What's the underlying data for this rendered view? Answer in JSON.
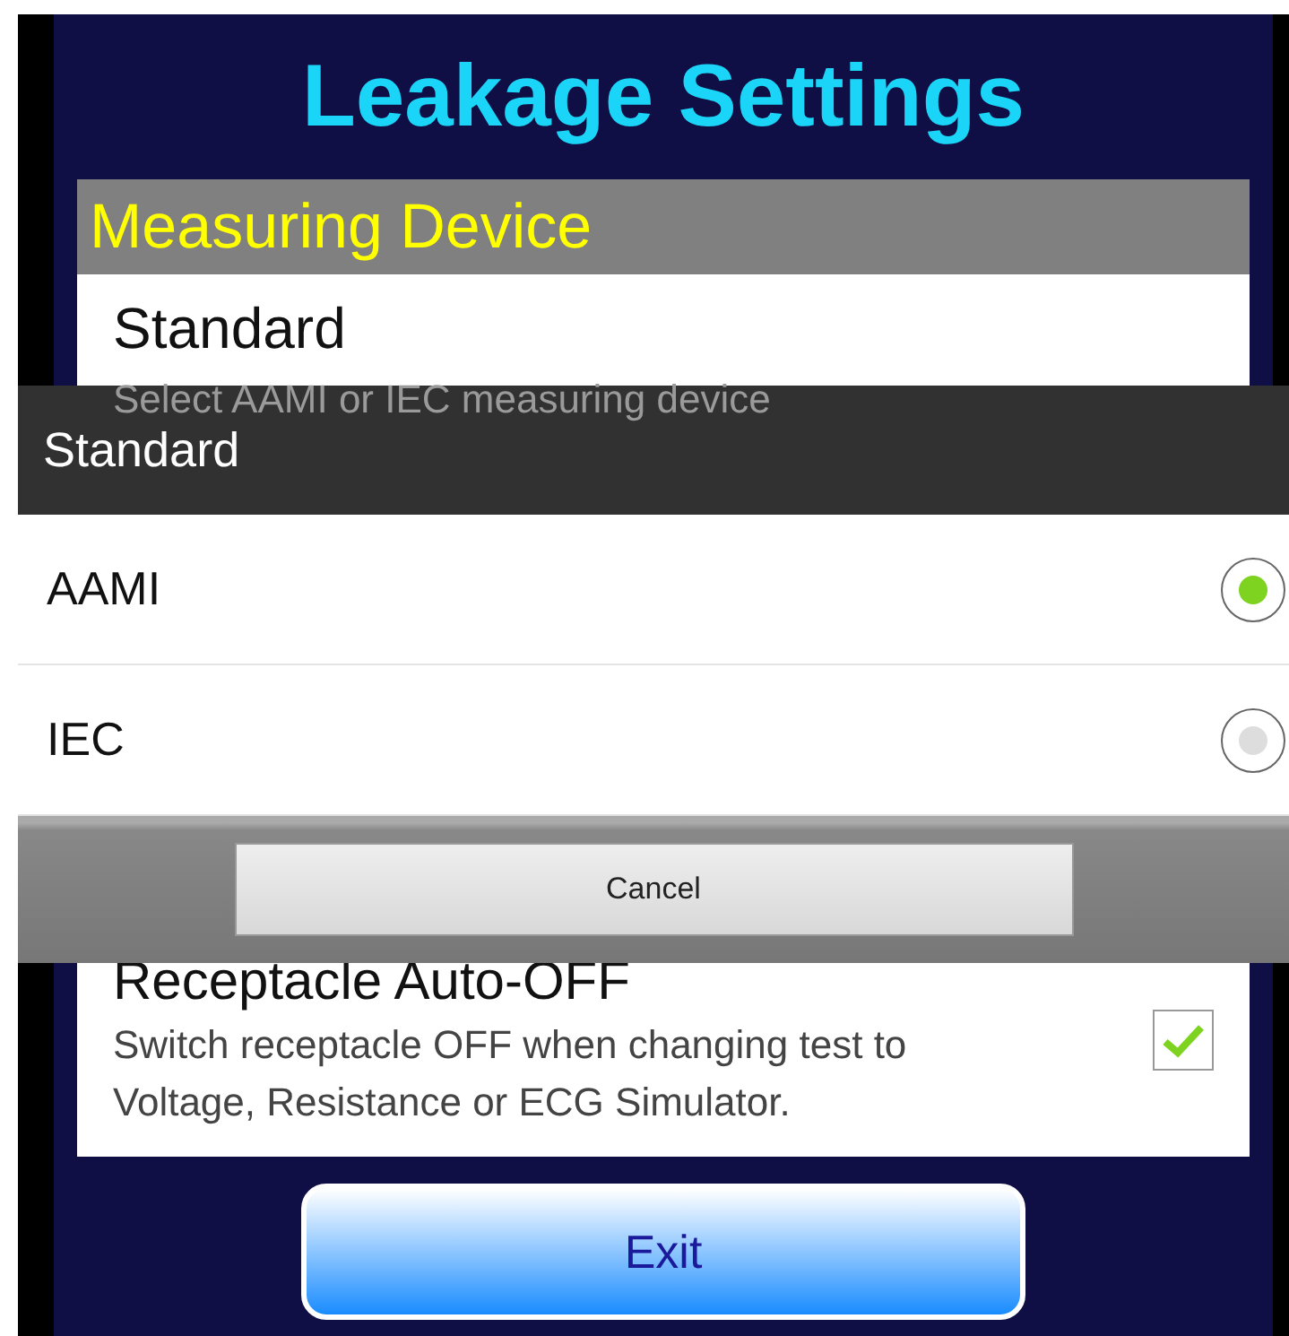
{
  "screen": {
    "title": "Leakage Settings"
  },
  "settings": {
    "section_header": "Measuring Device",
    "items": [
      {
        "kind": "choice",
        "title": "Standard",
        "subtitle": "Select AAMI or IEC measuring device"
      },
      {
        "kind": "checkbox",
        "title": "Receptacle Auto-OFF",
        "subtitle": "Switch receptacle OFF when changing test to Voltage, Resistance or ECG Simulator.",
        "checked": true
      }
    ]
  },
  "dialog": {
    "title": "Standard",
    "options": [
      {
        "label": "AAMI",
        "selected": true
      },
      {
        "label": "IEC",
        "selected": false
      }
    ],
    "cancel_button": "Cancel"
  },
  "exit_button": "Exit"
}
